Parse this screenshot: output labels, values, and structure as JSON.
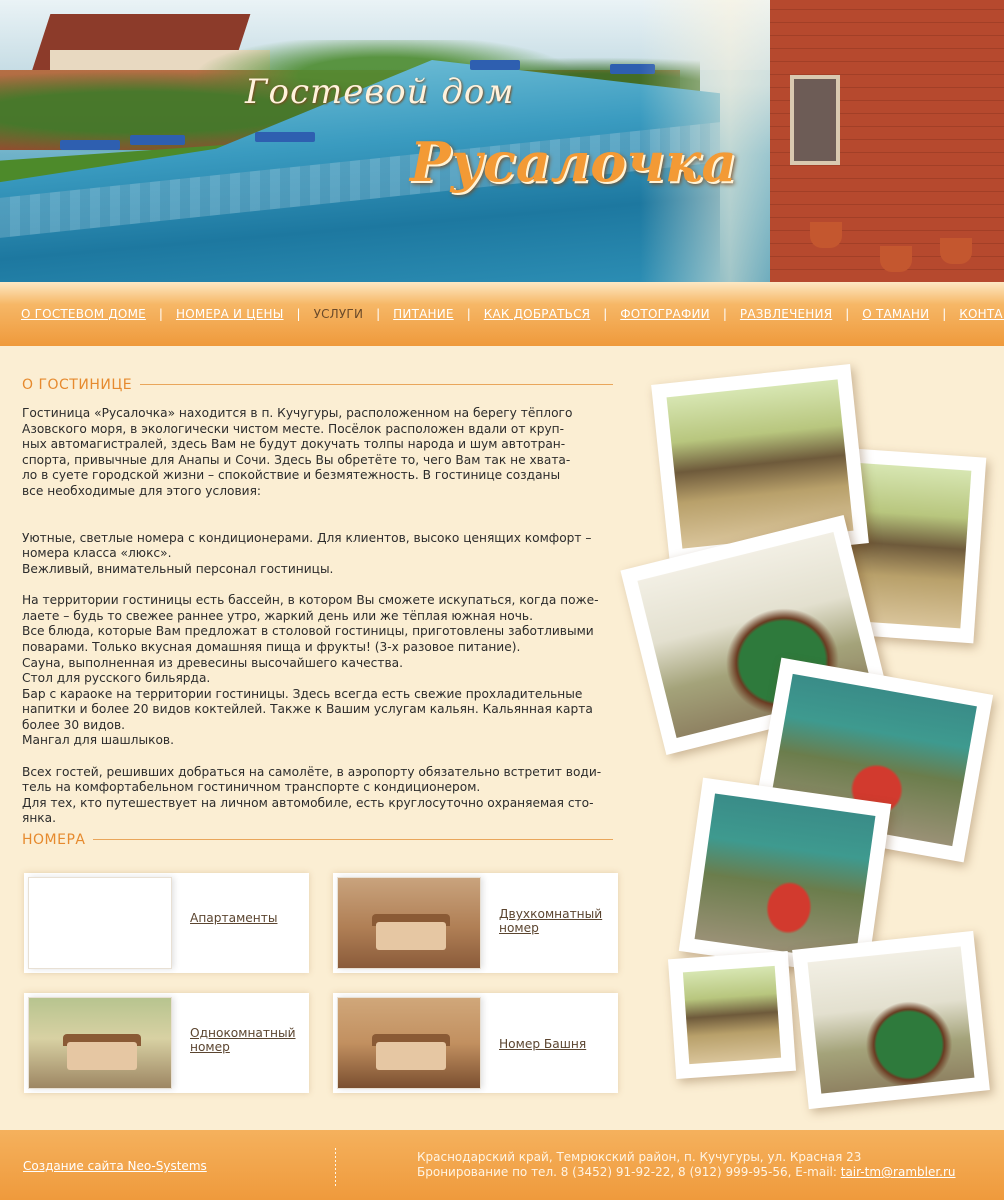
{
  "header": {
    "logo_top": "Гостевой дом",
    "logo_main": "Русалочка"
  },
  "nav": {
    "items": [
      {
        "label": "О ГОСТЕВОМ ДОМЕ"
      },
      {
        "label": "НОМЕРА И ЦЕНЫ"
      },
      {
        "label": "УСЛУГИ",
        "active": true
      },
      {
        "label": "ПИТАНИЕ"
      },
      {
        "label": "КАК ДОБРАТЬСЯ"
      },
      {
        "label": "ФОТОГРАФИИ"
      },
      {
        "label": "РАЗВЛЕЧЕНИЯ"
      },
      {
        "label": "О ТАМАНИ"
      },
      {
        "label": "КОНТАКТЫ"
      }
    ],
    "separator": "|"
  },
  "about": {
    "heading": "О ГОСТИНИЦЕ",
    "text": "Гостиница «Русалочка» находится в п. Кучугуры, расположенном на берегу тёплого\nАзовского моря, в экологически чистом месте. Посёлок расположен вдали от круп-\nных автомагистралей, здесь Вам не будут докучать толпы народа и шум автотран-\nспорта, привычные для Анапы и Сочи. Здесь Вы обретёте то, чего Вам так не хвата-\nло в суете городской жизни – спокойствие и безмятежность. В гостинице созданы\nвсе необходимые для этого условия:\n\n\nУютные, светлые номера с кондиционерами. Для клиентов, высоко ценящих комфорт –\nномера класса «люкс».\nВежливый, внимательный персонал гостиницы.\n\nНа территории гостиницы есть бассейн, в котором Вы сможете искупаться, когда поже-\nлаете – будь то свежее раннее утро, жаркий день или же тёплая южная ночь.\nВсе блюда, которые Вам предложат в столовой гостиницы, приготовлены заботливыми\nповарами. Только вкусная домашняя пища и фрукты! (3-х разовое питание).\nСауна, выполненная из древесины высочайшего качества.\nСтол для русского бильярда.\nБар с караоке на территории гостиницы. Здесь всегда есть свежие прохладительные\nнапитки и более 20 видов коктейлей. Также к Вашим услугам кальян. Кальянная карта\nболее 30 видов.\nМангал для шашлыков.\n\nВсех гостей, решивших добраться на самолёте, в аэропорту обязательно встретит води-\nтель на комфортабельном гостиничном транспорте с кондиционером.\nДля тех, кто путешествует на личном автомобиле, есть круглосуточно охраняемая сто-\nянка."
  },
  "rooms": {
    "heading": "НОМЕРА",
    "items": [
      {
        "label": "Апартаменты"
      },
      {
        "label": "Двухкомнатный номер "
      },
      {
        "label": "Однокомнатный номер"
      },
      {
        "label": "Номер Башня"
      }
    ]
  },
  "footer": {
    "credit": "Создание сайта Neo-Systems",
    "address": "Краснодарский край, Темрюкский район, п. Кучугуры, ул. Красная 23",
    "booking": "Бронирование по тел. 8 (3452) 91-92-22, 8 (912) 999-95-56, E-mail: ",
    "email": "tair-tm@rambler.ru"
  },
  "colors": {
    "accent": "#e68a2e",
    "nav_bg": "#ef9a3c",
    "page_bg": "#fbeed3"
  }
}
